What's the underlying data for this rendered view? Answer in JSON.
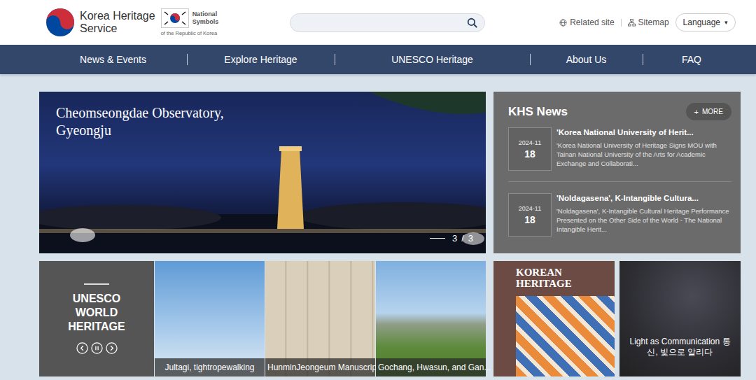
{
  "header": {
    "logo": {
      "line1": "Korea Heritage",
      "line2": "Service"
    },
    "symbols": {
      "line1": "National",
      "line2": "Symbols",
      "line3": "of the Republic of Korea"
    },
    "links": [
      "Related site",
      "Sitemap"
    ],
    "language": {
      "label": "Language",
      "caret": "▾"
    }
  },
  "nav": [
    {
      "label": "News & Events",
      "selected": false
    },
    {
      "label": "Explore Heritage",
      "selected": false
    },
    {
      "label": "UNESCO Heritage",
      "selected": false
    },
    {
      "label": "About Us",
      "selected": false
    },
    {
      "label": "FAQ",
      "selected": false
    }
  ],
  "hero": {
    "caption_line1": "Cheomseongdae Observatory,",
    "caption_line2": "Gyeongju",
    "pagination": {
      "current": "3",
      "separator": "/",
      "total": "3"
    }
  },
  "news": {
    "title": "KHS News",
    "more": {
      "icon": "+",
      "label": "MORE"
    },
    "items": [
      {
        "month": "2024-11",
        "day": "18",
        "title": "'Korea National University of Herit...",
        "summary": "'Korea National University of Heritage Signs MOU with Tainan National University of the Arts for Academic Exchange and Collaborati..."
      },
      {
        "month": "2024-11",
        "day": "18",
        "title": "'Noldagasena', K-Intangible Cultura...",
        "summary": "'Noldagasena', K-Intangible Cultural Heritage Performance Presented on the Other Side of the World - The National Intangible Herit..."
      }
    ]
  },
  "unesco": {
    "title_line1": "UNESCO",
    "title_line2": "WORLD",
    "title_line3": "HERITAGE",
    "tiles": [
      {
        "caption": "Jultagi, tightropewalking"
      },
      {
        "caption": "HunminJeongeum Manuscript"
      },
      {
        "caption": "Gochang, Hwasun, and Gan..."
      }
    ]
  },
  "banners": [
    {
      "kind": "title",
      "text": "KOREAN HERITAGE"
    },
    {
      "kind": "caption",
      "text": "Light as Communication 통신, 빛으로 알리다"
    }
  ]
}
